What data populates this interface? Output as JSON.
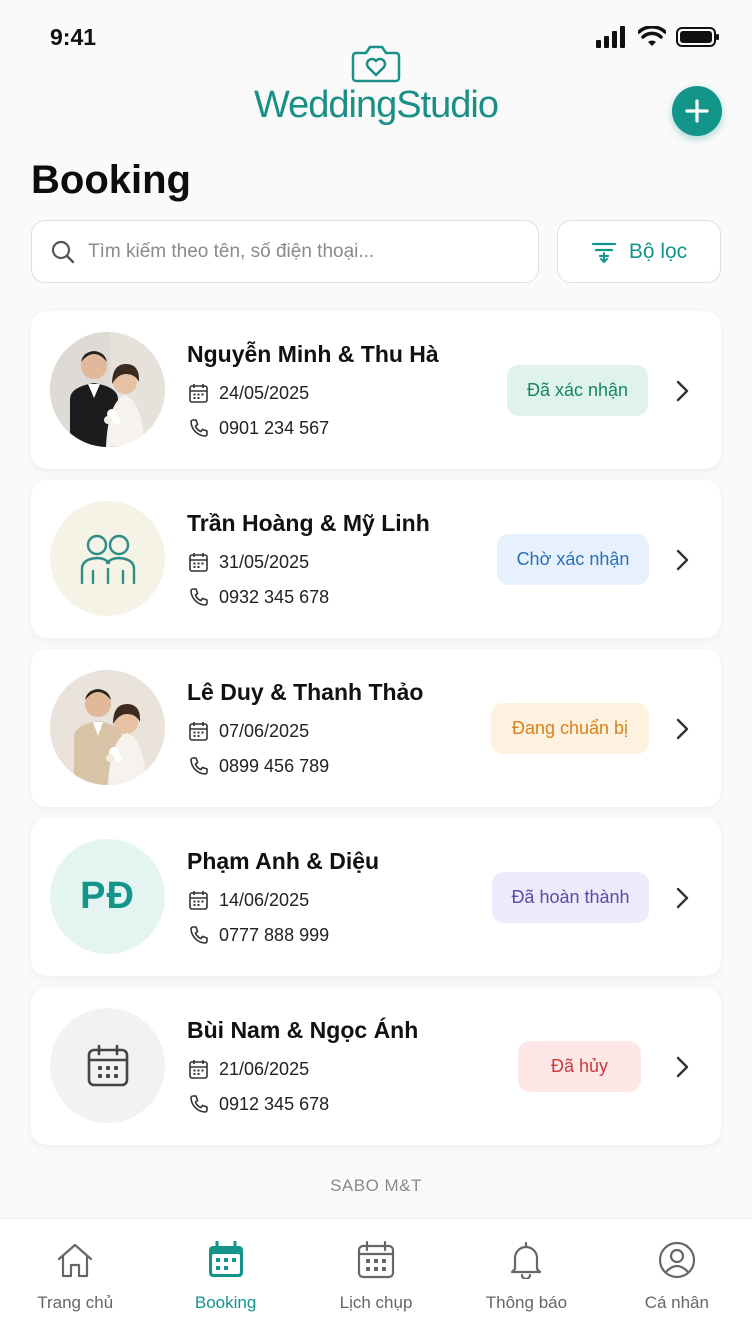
{
  "status_bar": {
    "time": "9:41"
  },
  "app": {
    "logo_text": "WeddingStudio",
    "brand_color": "#14958a"
  },
  "page": {
    "title": "Booking"
  },
  "search": {
    "placeholder": "Tìm kiếm theo tên, số điện thoại..."
  },
  "filter": {
    "label": "Bộ lọc"
  },
  "bookings": [
    {
      "name": "Nguyễn Minh & Thu Hà",
      "date": "24/05/2025",
      "phone": "0901 234 567",
      "status": "Đã xác nhận",
      "avatar": "couple-photo-icon"
    },
    {
      "name": "Trần Hoàng & Mỹ Linh",
      "date": "31/05/2025",
      "phone": "0932 345 678",
      "status": "Chờ xác nhận",
      "avatar": "couple-outline-icon"
    },
    {
      "name": "Lê Duy & Thanh Thảo",
      "date": "07/06/2025",
      "phone": "0899 456 789",
      "status": "Đang chuẩn bị",
      "avatar": "couple-photo-icon"
    },
    {
      "name": "Phạm Anh & Diệu",
      "date": "14/06/2025",
      "phone": "0777 888 999",
      "status": "Đã hoàn thành",
      "avatar_initials": "PĐ"
    },
    {
      "name": "Bùi Nam & Ngọc Ánh",
      "date": "21/06/2025",
      "phone": "0912 345 678",
      "status": "Đã hủy",
      "avatar": "calendar-icon"
    }
  ],
  "status_colors": {
    "confirmed": {
      "bg": "#dff3ea",
      "fg": "#17865e"
    },
    "pending": {
      "bg": "#e6f1fd",
      "fg": "#2a6fb5"
    },
    "preparing": {
      "bg": "#fdf1df",
      "fg": "#d9821a"
    },
    "completed": {
      "bg": "#eeeafc",
      "fg": "#5e4aa8"
    },
    "cancelled": {
      "bg": "#fde7e7",
      "fg": "#cc3b3b"
    }
  },
  "footer": {
    "brand": "SABO M&T"
  },
  "nav": [
    {
      "label": "Trang chủ",
      "icon": "home-icon"
    },
    {
      "label": "Booking",
      "icon": "calendar-check-icon",
      "active": true
    },
    {
      "label": "Lịch chụp",
      "icon": "calendar-icon"
    },
    {
      "label": "Thông báo",
      "icon": "bell-icon"
    },
    {
      "label": "Cá nhân",
      "icon": "user-icon"
    }
  ]
}
